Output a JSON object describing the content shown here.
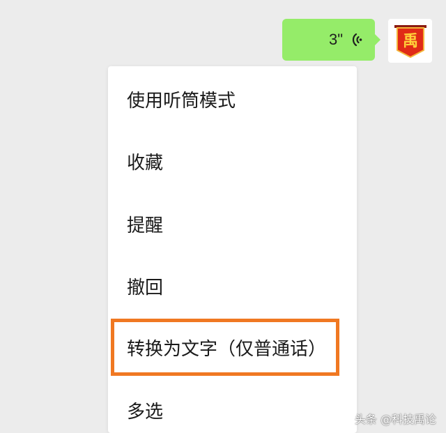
{
  "voice_message": {
    "duration": "3\"",
    "icon": "voice-wave-icon",
    "bubble_color": "#95ec69"
  },
  "avatar": {
    "character": "禹",
    "icon": "banner-avatar-icon"
  },
  "context_menu": {
    "items": [
      {
        "label": "使用听筒模式"
      },
      {
        "label": "收藏"
      },
      {
        "label": "提醒"
      },
      {
        "label": "撤回"
      },
      {
        "label": "转换为文字（仅普通话）"
      },
      {
        "label": "多选"
      }
    ],
    "highlight_color": "#f07822"
  },
  "watermark": {
    "text": "头条 @科技禹论"
  }
}
